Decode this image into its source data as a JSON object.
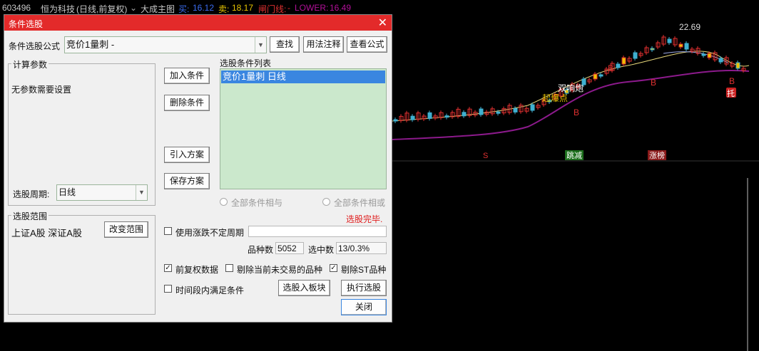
{
  "header": {
    "stock_code": "603496",
    "stock_name": "恒为科技",
    "period": "(日线,前复权)",
    "main_chart": "大成主图",
    "buy_label": "买:",
    "buy_value": "16.12",
    "sell_label": "卖:",
    "sell_value": "18.17",
    "gate_label": "闸门线:",
    "gate_value": "-",
    "lower_label": "LOWER:",
    "lower_value": "16.49"
  },
  "chart": {
    "peak_price": "22.69",
    "annotations": [
      "双响炮",
      "起爆点",
      "B",
      "B",
      "B",
      "B",
      "托"
    ],
    "indicator_tags": [
      "S",
      "跳减",
      "涨榜"
    ]
  },
  "dialog": {
    "title": "条件选股",
    "close": "✕",
    "formula_label": "条件选股公式",
    "formula_value": "竞价1量刺    -",
    "find_btn": "查找",
    "usage_btn": "用法注释",
    "view_formula_btn": "查看公式",
    "params_group": "计算参数",
    "params_text": "无参数需要设置",
    "period_label": "选股周期:",
    "period_value": "日线",
    "add_btn": "加入条件",
    "delete_btn": "删除条件",
    "import_btn": "引入方案",
    "save_btn": "保存方案",
    "list_title": "选股条件列表",
    "list_items": [
      "竞价1量刺  日线"
    ],
    "radio_and": "全部条件相与",
    "radio_or": "全部条件相或",
    "status": "选股完毕.",
    "range_group": "选股范围",
    "range_text": "上证A股 深证A股",
    "change_range_btn": "改变范围",
    "use_change_label": "使用涨跌不定周期",
    "count_label": "品种数",
    "count_value": "5052",
    "selected_label": "选中数",
    "selected_value": "13/0.3%",
    "fq_label": "前复权数据",
    "fq_checked": true,
    "exclude_untraded_label": "剔除当前未交易的品种",
    "exclude_untraded_checked": false,
    "exclude_st_label": "剔除ST品种",
    "exclude_st_checked": true,
    "time_range_label": "时间段内满足条件",
    "time_range_checked": false,
    "to_block_btn": "选股入板块",
    "execute_btn": "执行选股",
    "close_btn": "关闭"
  }
}
